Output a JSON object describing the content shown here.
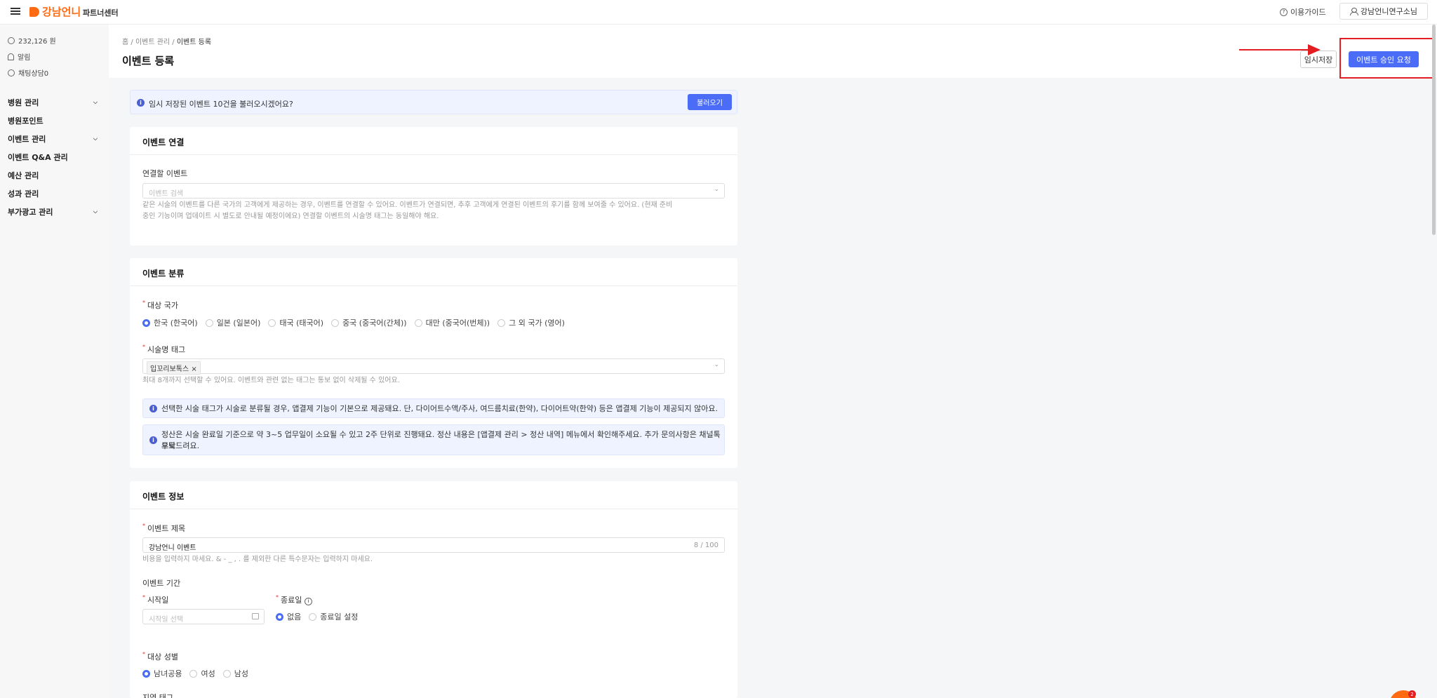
{
  "header": {
    "logo": "강남언니",
    "partner": "파트너센터",
    "guide": "이용가이드",
    "user": "강남언니연구소님"
  },
  "sidebar": {
    "points": "232,126 원",
    "alarm": "알림",
    "chat": "채팅상담0",
    "menu": [
      {
        "label": "병원 관리"
      },
      {
        "label": "병원포인트"
      },
      {
        "label": "이벤트 관리"
      },
      {
        "label": "이벤트 Q&A 관리"
      },
      {
        "label": "예산 관리"
      },
      {
        "label": "성과 관리"
      },
      {
        "label": "부가광고 관리"
      }
    ]
  },
  "breadcrumb": {
    "home": "홈",
    "parent": "이벤트 관리",
    "current": "이벤트 등록"
  },
  "page": {
    "title": "이벤트 등록",
    "temp_save": "임시저장",
    "approve": "이벤트 승인 요청"
  },
  "notice": {
    "text": "임시 저장된 이벤트 10건을 불러오시겠어요?",
    "load": "불러오기"
  },
  "link_section": {
    "title": "이벤트 연결",
    "label": "연결할 이벤트",
    "placeholder": "이벤트 검색",
    "help1": "같은 시술의 이벤트를 다른 국가의 고객에게 제공하는 경우, 이벤트를 연결할 수 있어요. 이벤트가 연결되면, 추후 고객에게 연결된 이벤트의 후기를 함께 보여줄 수 있어요. (현재 준비",
    "help2": "중인 기능이며 업데이트 시 별도로 안내될 예정이에요) 연결할 이벤트의 시술명 태그는 동일해야 해요."
  },
  "category_section": {
    "title": "이벤트 분류",
    "country_label": "대상 국가",
    "countries": [
      {
        "label": "한국 (한국어)"
      },
      {
        "label": "일본 (일본어)"
      },
      {
        "label": "태국 (태국어)"
      },
      {
        "label": "중국 (중국어(간체))"
      },
      {
        "label": "대만 (중국어(번체))"
      },
      {
        "label": "그 외 국가 (영어)"
      }
    ],
    "tag_label": "시술명 태그",
    "tag_value": "입꼬리보톡스 ×",
    "tag_help": "최대 8개까지 선택할 수 있어요. 이벤트와 관련 없는 태그는 통보 없이 삭제될 수 있어요.",
    "info1": "선택한 시술 태그가 시술로 분류될 경우, 앱결제 기능이 기본으로 제공돼요. 단, 다이어트수액/주사, 여드름치료(한약), 다이어트약(한약) 등은 앱결제 기능이 제공되지 않아요.",
    "info2a": "정산은 시술 완료일 기준으로 약 3~5 업무일이 소요될 수 있고 2주 단위로 진행돼요. 정산 내용은 [앱결제 관리 > 정산 내역] 메뉴에서 확인해주세요. 추가 문의사항은 채널톡으로",
    "info2b": "부탁드려요."
  },
  "info_section": {
    "title": "이벤트 정보",
    "title_label": "이벤트 제목",
    "title_value": "강남언니 이벤트",
    "title_count": "8 / 100",
    "title_help": "비용을 입력하지 마세요. & - _ , . 를 제외한 다른 특수문자는 입력하지 마세요.",
    "period_label": "이벤트 기간",
    "start_label": "시작일",
    "start_placeholder": "시작일 선택",
    "end_label": "종료일",
    "end_options": [
      {
        "label": "없음"
      },
      {
        "label": "종료일 설정"
      }
    ],
    "gender_label": "대상 성별",
    "genders": [
      {
        "label": "남녀공용"
      },
      {
        "label": "여성"
      },
      {
        "label": "남성"
      }
    ],
    "next_label": "지역 태그"
  },
  "badge": "2"
}
